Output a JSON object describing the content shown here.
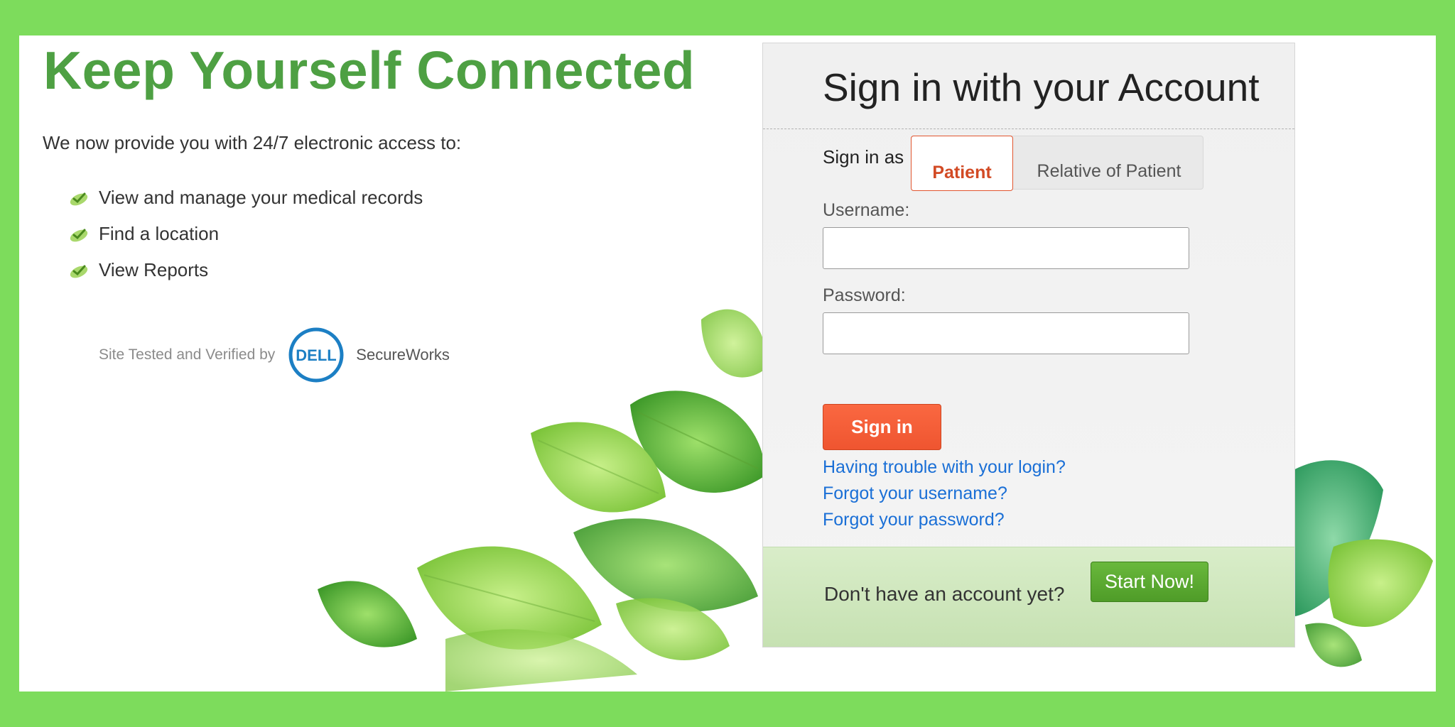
{
  "headline": "Keep Yourself Connected",
  "intro": "We now provide you with 24/7 electronic access to:",
  "features": [
    "View and manage your medical records",
    "Find a location",
    "View Reports"
  ],
  "verified": {
    "text": "Site Tested and Verified by",
    "logo_text": "DELL",
    "partner": "SecureWorks"
  },
  "signin": {
    "title": "Sign in with your Account",
    "sign_in_as": "Sign in as",
    "roles": [
      "Patient",
      "Relative of Patient"
    ],
    "selected_role": "Patient",
    "username_label": "Username:",
    "username_value": "",
    "password_label": "Password:",
    "password_value": "",
    "button": "Sign in",
    "links": [
      "Having trouble with your login?",
      "Forgot your username?",
      "Forgot your password?"
    ]
  },
  "footer": {
    "prompt": "Don't have an account yet?",
    "button": "Start Now!"
  },
  "colors": {
    "page_background": "#7ddc5c",
    "headline": "#4ea043",
    "accent_orange": "#ef5530",
    "link_blue": "#1a6fd6",
    "start_green": "#5aa932"
  },
  "icons": [
    "check-icon",
    "dell-logo-icon",
    "leaf-decoration"
  ]
}
